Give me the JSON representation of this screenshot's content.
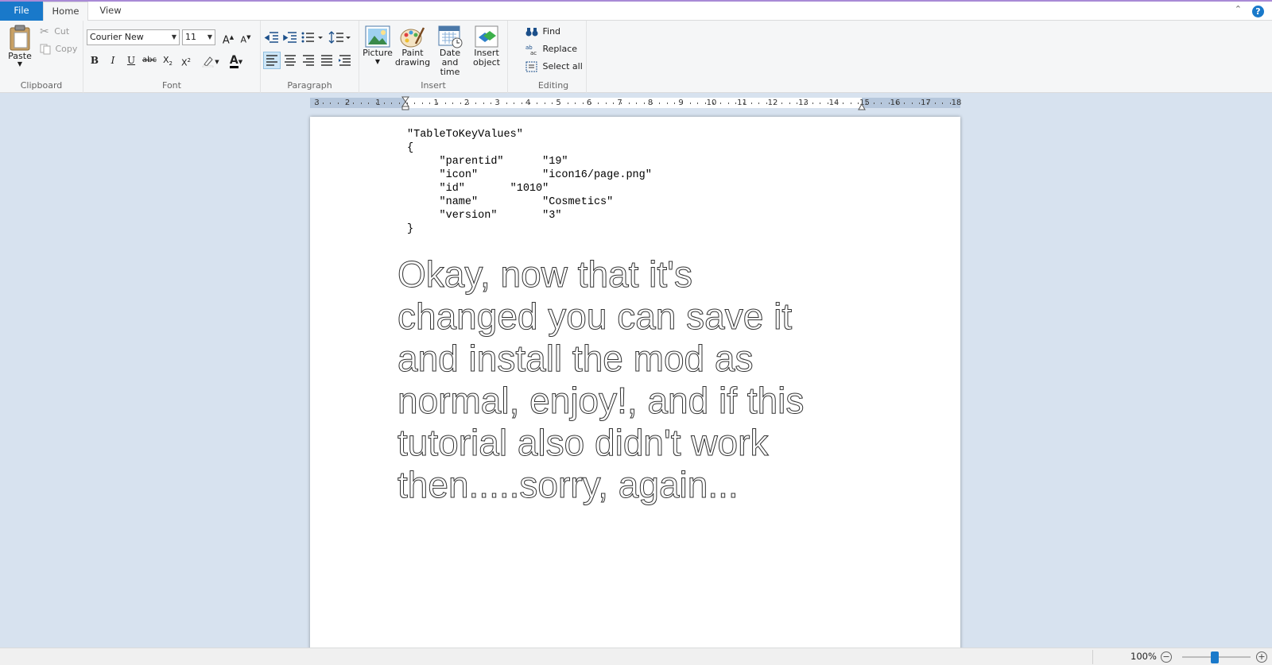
{
  "tabs": {
    "file": "File",
    "home": "Home",
    "view": "View"
  },
  "ribbon": {
    "clipboard": {
      "label": "Clipboard",
      "paste": "Paste",
      "cut": "Cut",
      "copy": "Copy"
    },
    "font": {
      "label": "Font",
      "family": "Courier New",
      "size": "11"
    },
    "paragraph": {
      "label": "Paragraph"
    },
    "insert": {
      "label": "Insert",
      "picture": "Picture",
      "paint_drawing": [
        "Paint",
        "drawing"
      ],
      "date_time": [
        "Date and",
        "time"
      ],
      "insert_object": [
        "Insert",
        "object"
      ]
    },
    "editing": {
      "label": "Editing",
      "find": "Find",
      "replace": "Replace",
      "select_all": "Select all"
    }
  },
  "ruler": {
    "left_numbers": [
      "3",
      "2",
      "1"
    ],
    "right_numbers": [
      "1",
      "2",
      "3",
      "4",
      "5",
      "6",
      "7",
      "8",
      "9",
      "10",
      "11",
      "12",
      "13",
      "14",
      "15",
      "16",
      "17",
      "18"
    ]
  },
  "document": {
    "code_lines": [
      "\"TableToKeyValues\"",
      "{",
      "     \"parentid\"      \"19\"",
      "     \"icon\"          \"icon16/page.png\"",
      "     \"id\"       \"1010\"",
      "     \"name\"          \"Cosmetics\"",
      "     \"version\"       \"3\"",
      "}"
    ],
    "big_text": "Okay, now that it's changed you can save it and install the mod as normal, enjoy!, and if this tutorial also didn't work then.....sorry, again..."
  },
  "status": {
    "zoom": "100%"
  },
  "colors": {
    "accent": "#1979ca",
    "ribbon_bg": "#f5f6f7",
    "doc_bg": "#d7e2ef"
  }
}
